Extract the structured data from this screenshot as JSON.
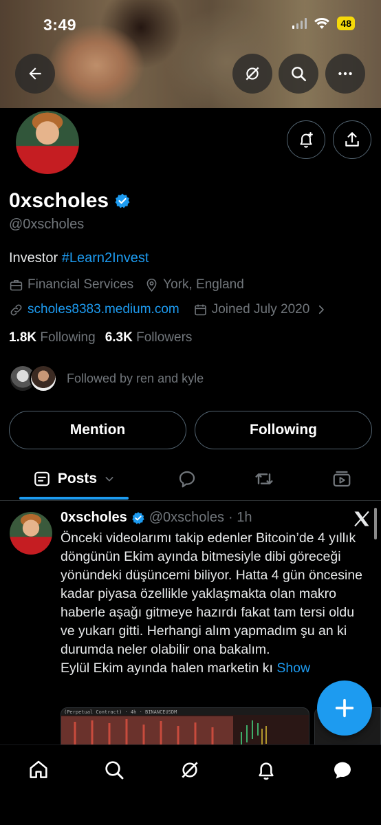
{
  "status_bar": {
    "time": "3:49",
    "battery": "48"
  },
  "icons": {
    "back": "back-arrow-icon",
    "grok": "grok-icon",
    "search": "search-icon",
    "more": "more-icon",
    "notify": "bell-plus-icon",
    "share": "share-icon",
    "verified": "verified-badge-icon",
    "work": "briefcase-icon",
    "location": "location-pin-icon",
    "link": "link-icon",
    "calendar": "calendar-icon"
  },
  "profile": {
    "name": "0xscholes",
    "handle": "@0xscholes",
    "bio_text": "Investor ",
    "bio_hashtag": "#Learn2Invest",
    "category": "Financial Services",
    "location": "York, England",
    "website": "scholes8383.medium.com",
    "joined": "Joined July 2020",
    "following_count": "1.8K",
    "following_label": "Following",
    "followers_count": "6.3K",
    "followers_label": "Followers",
    "followed_by": "Followed by ren and kyle"
  },
  "actions": {
    "mention": "Mention",
    "following": "Following"
  },
  "tabs": {
    "posts": "Posts"
  },
  "post": {
    "name": "0xscholes",
    "handle": "@0xscholes",
    "time": "· 1h",
    "text": "Önceki videolarımı takip edenler Bitcoin’de 4 yıllık döngünün Ekim ayında bitmesiyle dibi göreceği yönündeki düşüncemi biliyor. Hatta 4 gün öncesine kadar piyasa özellikle yaklaşmakta olan makro haberle aşağı gitmeye hazırdı fakat tam tersi oldu ve yukarı gitti. Herhangi alım yapmadım şu an ki durumda neler olabilir ona bakalım.\nEylül Ekim ayında halen marketin kı",
    "show_more": "Show",
    "chart_caption": "(Perpetual Contract) · 4h · BINANCEUSDM"
  },
  "colors": {
    "accent": "#1d9bf0",
    "background": "#000000",
    "muted": "#71767b"
  }
}
